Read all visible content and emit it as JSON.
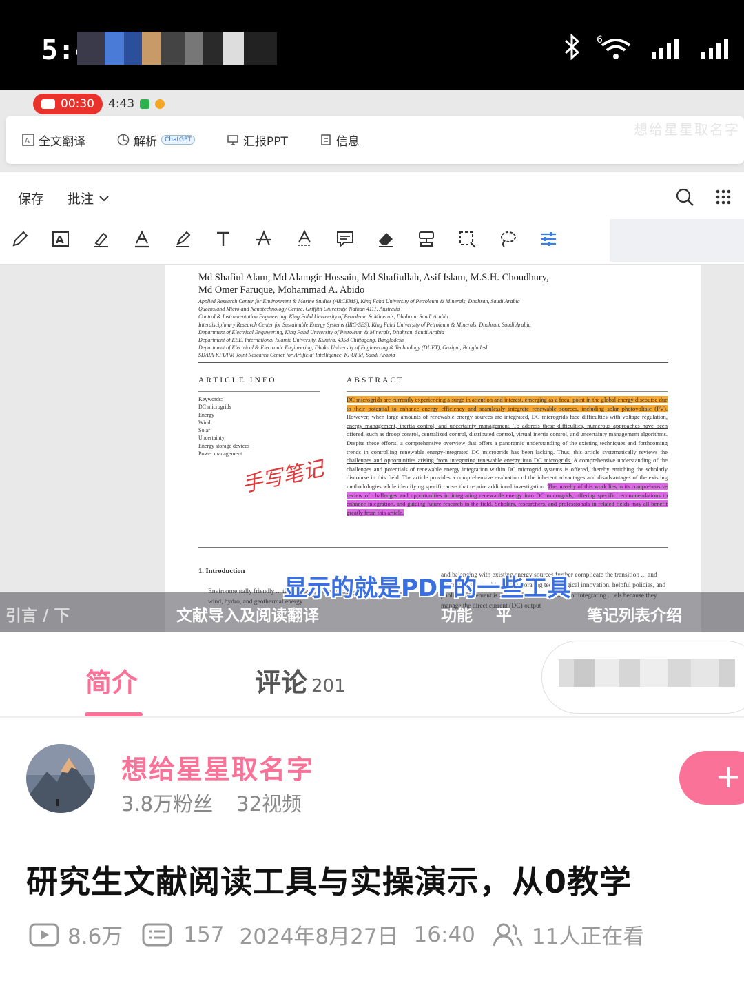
{
  "status_bar": {
    "time": "5:4",
    "signal_badge": "6"
  },
  "recorder": {
    "elapsed": "00:30",
    "clock": "4:43"
  },
  "pdf_app": {
    "top_tools": [
      {
        "label": "全文翻译",
        "icon": "translate-icon"
      },
      {
        "label": "解析",
        "icon": "analysis-icon",
        "badge": "ChatGPT"
      },
      {
        "label": "汇报PPT",
        "icon": "presentation-icon"
      },
      {
        "label": "信息",
        "icon": "info-icon"
      }
    ],
    "faded_title": "想给星星取名字",
    "save_label": "保存",
    "annotate_label": "批注",
    "annotation_tools": [
      "pen-icon",
      "text-box-icon",
      "highlighter-icon",
      "text-color-icon",
      "marker-icon",
      "text-icon",
      "strikethrough-icon",
      "underline-icon",
      "comment-icon",
      "eraser-icon",
      "stamp-icon",
      "area-select-icon",
      "lasso-icon",
      "settings-sliders-icon"
    ]
  },
  "pdf": {
    "authors_line1": "Md Shafiul Alam",
    "authors_line1_rest": ", Md Alamgir Hossain, Md Shafiullah, Asif Islam, M.S.H. Choudhury,",
    "authors_line2": "Md Omer Faruque, Mohammad A. Abido",
    "affiliations": [
      "Applied Research Center for Environment & Marine Studies (ARCEMS), King Fahd University of Petroleum & Minerals, Dhahran, Saudi Arabia",
      "Queensland Micro and Nanotechnology Centre, Griffith University, Nathan 4111, Australia",
      "Control & Instrumentation Engineering, King Fahd University of Petroleum & Minerals, Dhahran, Saudi Arabia",
      "Interdisciplinary Research Center for Sustainable Energy Systems (IRC-SES), King Fahd University of Petroleum & Minerals, Dhahran, Saudi Arabia",
      "Department of Electrical Engineering, King Fahd University of Petroleum & Minerals, Dhahran, Saudi Arabia",
      "Department of EEE, International Islamic University, Kumira, 4358 Chittagong, Bangladesh",
      "Department of Electrical & Electronic Engineering, Dhaka University of Engineering & Technology (DUET), Gazipur, Bangladesh",
      "SDAIA-KFUPM Joint Research Center for Artificial Intelligence, KFUPM, Saudi Arabia"
    ],
    "article_info_heading": "ARTICLE INFO",
    "abstract_heading": "ABSTRACT",
    "keywords": [
      "Keywords:",
      "DC microgrids",
      "Energy",
      "Wind",
      "Solar",
      "Uncertainty",
      "Energy storage devices",
      "Power management"
    ],
    "abstract_hl1": "DC microgrids are currently experiencing a surge in attention and interest, emerging as a focal point in the global energy discourse due to their potential to enhance energy efficiency and seamlessly integrate renewable sources, including solar photovoltaic (PV).",
    "abstract_mid1": " However, when large amounts of renewable energy sources are integrated, DC ",
    "abstract_ul1": "microgrids face difficulties with voltage regulation, energy management, inertia control, and uncertainty management. To address these difficulties, numerous approaches have been offered, such as droop control, centralized control,",
    "abstract_mid2": " distributed control, virtual inertia control, and uncertainty management algorithms. Despite these efforts, a comprehensive overview that offers a panoramic understanding of the existing techniques and forthcoming trends in controlling renewable energy-integrated DC microgrids has been lacking. Thus, this article systematically ",
    "abstract_ul2": "reviews the challenges and opportunities arising from integrating renewable energy into DC microgrids.",
    "abstract_mid3": " A comprehensive understanding of the challenges and potentials of renewable energy integration within DC microgrid systems is offered, thereby enriching the scholarly discourse in this field. The article provides a comprehensive evaluation of the inherent advantages and disadvantages of the existing methodologies while identifying specific areas that require additional investigation. ",
    "abstract_hl2": "The novelty of this work lies in its comprehensive review of challenges and opportunities in integrating renewable energy into DC microgrids, offering specific recommendations to enhance integration, and guiding future research in the field. Scholars, researchers, and professionals in related fields may all benefit greatly from this article.",
    "handwritten_note": "手写笔记",
    "intro_heading": "1. Introduction",
    "intro_left": "Environmentally friendly ... tional fossil fuels encompass solar, wind, hydro, and geothermal energy",
    "intro_right": "and balancing with existing energy sources further complicate the transition ... and establish a sustainable ... incorporating technological innovation, helpful policies, and public involvement is required. DC ... important for integrating ... els because they manage the direct current (DC) output"
  },
  "captions": {
    "main": "显示的就是PDF的一些工具",
    "lower": "文献导入及阅读翻译",
    "left_fragment": "引言 / 下",
    "mid_fragment": "功能",
    "mid_fragment2": "平",
    "right_fragment": "笔记列表介绍"
  },
  "tabs": {
    "intro": "简介",
    "comments": "评论",
    "comments_count": "201"
  },
  "uploader": {
    "name": "想给星星取名字",
    "followers": "3.8万粉丝",
    "videos": "32视频",
    "follow_symbol": "+"
  },
  "video": {
    "title": "研究生文献阅读工具与实操演示，从0教学",
    "plays": "8.6万",
    "danmaku": "157",
    "date": "2024年8月27日",
    "time": "16:40",
    "watching": "11人正在看"
  },
  "colors": {
    "brand_pink": "#fb7299",
    "record_red": "#e8322b",
    "highlight_orange": "#f7a832",
    "highlight_purple": "#dd66e6",
    "caption_blue": "#3a6fe0"
  }
}
